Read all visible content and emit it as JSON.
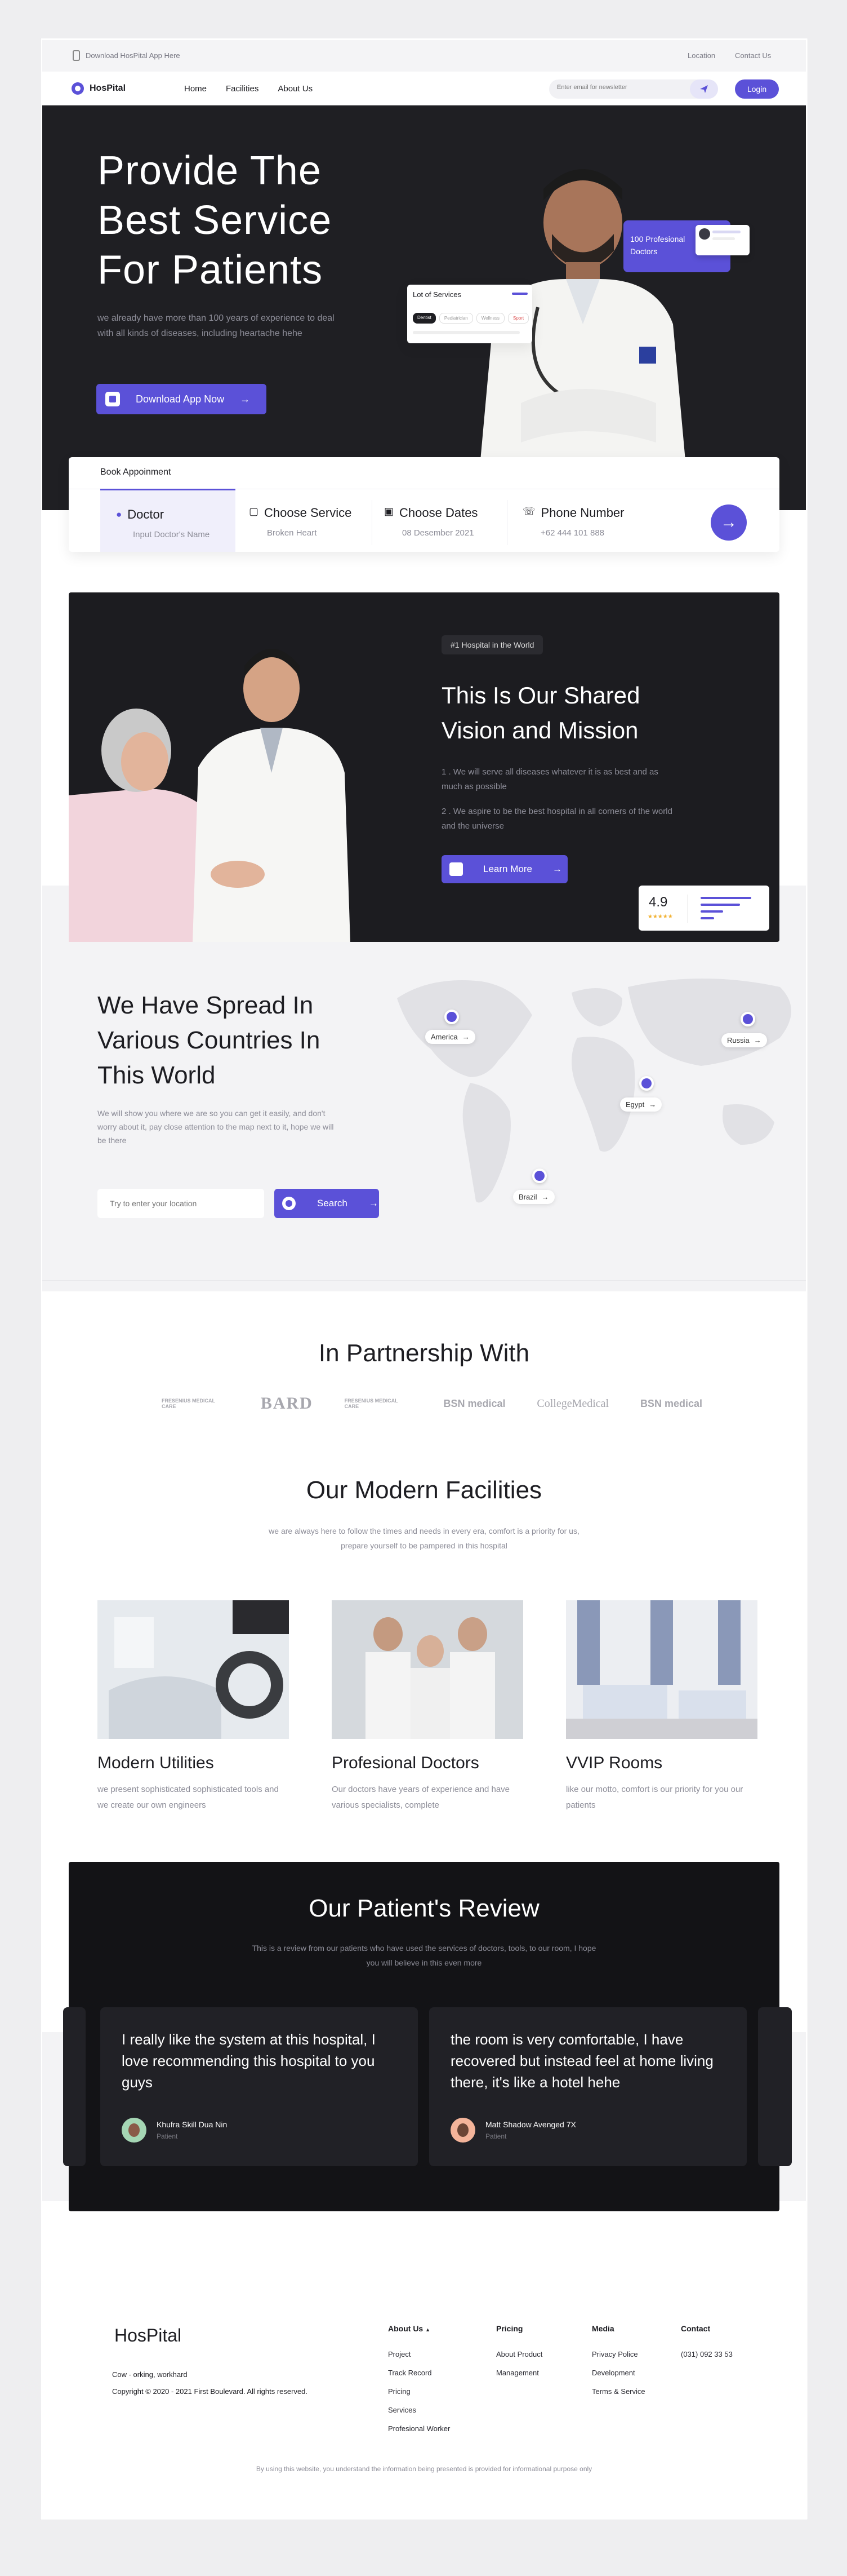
{
  "topbar": {
    "download": "Download HosPital App Here",
    "location": "Location",
    "contact": "Contact Us"
  },
  "nav": {
    "logo": "HosPital",
    "items": [
      "Home",
      "Facilities",
      "About Us"
    ],
    "subscribe_placeholder": "Enter email for newsletter",
    "login": "Login"
  },
  "hero": {
    "title_l1": "Provide The",
    "title_l2": "Best Service",
    "title_l3": "For Patients",
    "desc": "we already have more than 100 years of experience to deal with all kinds of diseases, including heartache hehe",
    "cta": "Download App Now",
    "services_card": {
      "title": "Lot of Services",
      "chips": [
        "Dentist",
        "Pediatrician",
        "Wellness",
        "Sport"
      ]
    },
    "prof_badge": "100 Profesional Doctors"
  },
  "booking": {
    "tab": "Book Appoinment",
    "fields": [
      {
        "label": "Doctor",
        "value": "Input Doctor's Name"
      },
      {
        "label": "Choose Service",
        "value": "Broken Heart"
      },
      {
        "label": "Choose Dates",
        "value": "08 Desember 2021"
      },
      {
        "label": "Phone Number",
        "value": "+62 444 101 888"
      }
    ]
  },
  "vision": {
    "badge": "#1 Hospital in the World",
    "title_l1": "This Is Our Shared",
    "title_l2": "Vision and Mission",
    "point1": "1 . We will serve all diseases whatever it is as best and as much as possible",
    "point2": "2 . We aspire to be the best hospital in all corners of the world and the universe",
    "cta": "Learn More",
    "rating": "4.9",
    "stars": "★★★★★"
  },
  "spread": {
    "title_l1": "We Have Spread In",
    "title_l2": "Various Countries In",
    "title_l3": "This World",
    "desc": "We will show you where we are so you can get it easily, and don't worry about it, pay close attention to the map next to it, hope we will be there",
    "search_placeholder": "Try to enter your location",
    "search_btn": "Search",
    "pins": [
      {
        "name": "America"
      },
      {
        "name": "Egypt"
      },
      {
        "name": "Brazil"
      },
      {
        "name": "Russia"
      }
    ]
  },
  "partners": {
    "title": "In Partnership With",
    "logos": [
      "FRESENIUS MEDICAL CARE",
      "BARD",
      "FRESENIUS MEDICAL CARE",
      "BSN medical",
      "CollegeMedical",
      "BSN medical"
    ]
  },
  "facilities": {
    "title": "Our Modern Facilities",
    "desc_l1": "we are always here to follow the times and needs in every era, comfort is a priority for us,",
    "desc_l2": "prepare yourself to be pampered in this hospital",
    "items": [
      {
        "title": "Modern Utilities",
        "desc": "we present sophisticated sophisticated tools and we create our own engineers"
      },
      {
        "title": "Profesional Doctors",
        "desc": "Our doctors have years of experience and have various specialists, complete"
      },
      {
        "title": "VVIP Rooms",
        "desc": "like our motto, comfort is our priority for you our patients"
      }
    ]
  },
  "reviews": {
    "title": "Our Patient's Review",
    "desc_l1": "This is a review from our patients who have used the services of doctors, tools, to our room, I hope",
    "desc_l2": "you will believe in this even more",
    "items": [
      {
        "text": "I really like the system at this hospital, I love recommending this hospital to you guys",
        "name": "Khufra Skill Dua Nin",
        "role": "Patient"
      },
      {
        "text": "the room is very comfortable, I have recovered but instead feel at home living there, it's like a hotel hehe",
        "name": "Matt Shadow Avenged 7X",
        "role": "Patient"
      }
    ]
  },
  "footer": {
    "logo": "HosPital",
    "tagline": "Cow - orking, workhard",
    "copyright": "Copyright © 2020 - 2021 First Boulevard. All rights reserved.",
    "cols": [
      {
        "title": "About Us",
        "links": [
          "Project",
          "Track Record",
          "Pricing",
          "Services",
          "Profesional Worker"
        ]
      },
      {
        "title": "Pricing",
        "links": [
          "About Product",
          "Management"
        ]
      },
      {
        "title": "Media",
        "links": [
          "Privacy Police",
          "Development",
          "Terms & Service"
        ]
      },
      {
        "title": "Contact",
        "links": [
          "(031) 092 33 53"
        ]
      }
    ],
    "disclaimer": "By using this website, you understand the information being presented is provided for informational purpose only"
  },
  "colors": {
    "accent": "#5b51d8",
    "dark": "#1f1f23"
  }
}
